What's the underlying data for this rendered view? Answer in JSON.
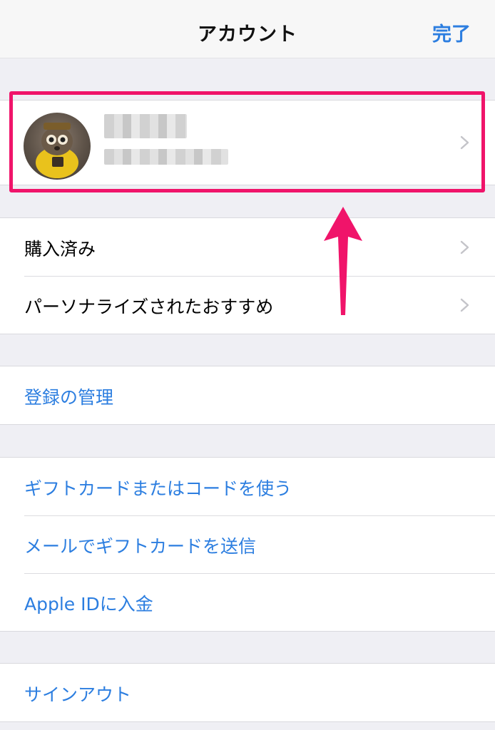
{
  "navbar": {
    "title": "アカウント",
    "done_label": "完了"
  },
  "profile": {
    "name_blurred": "",
    "email_blurred": ""
  },
  "section_store": {
    "items": [
      {
        "label": "購入済み"
      },
      {
        "label": "パーソナライズされたおすすめ"
      }
    ]
  },
  "section_subscriptions": {
    "items": [
      {
        "label": "登録の管理"
      }
    ]
  },
  "section_gift": {
    "items": [
      {
        "label": "ギフトカードまたはコードを使う"
      },
      {
        "label": "メールでギフトカードを送信"
      },
      {
        "label": "Apple IDに入金"
      }
    ]
  },
  "section_signout": {
    "items": [
      {
        "label": "サインアウト"
      }
    ]
  },
  "colors": {
    "accent": "#2c7ee0",
    "highlight": "#f0146a",
    "background": "#efeff4"
  }
}
